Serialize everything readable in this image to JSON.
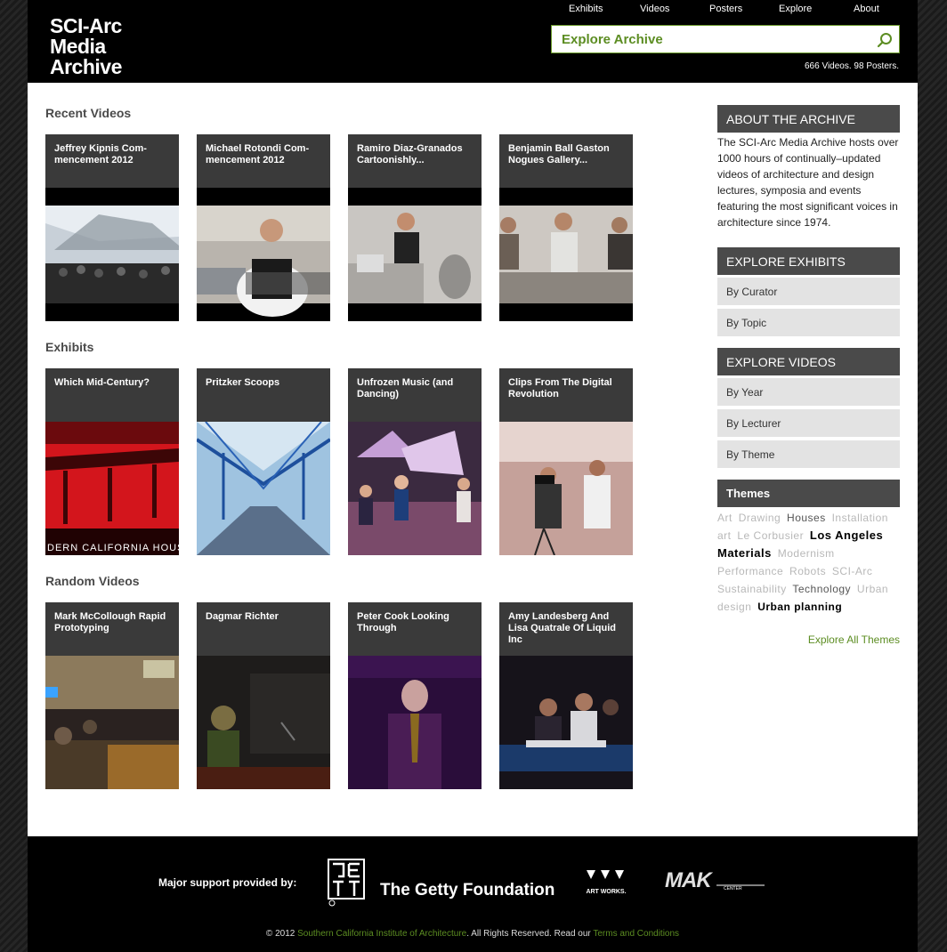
{
  "header": {
    "logo_lines": [
      "SCI-Arc",
      "Media",
      "Archive"
    ],
    "nav": [
      "Exhibits",
      "Videos",
      "Posters",
      "Explore",
      "About"
    ],
    "search_placeholder": "Explore Archive",
    "counts": "666 Videos. 98 Posters."
  },
  "sections": [
    {
      "title": "Recent Videos",
      "cards": [
        {
          "title": "Jeffrey Kipnis Com-mencement 2012"
        },
        {
          "title": "Michael Rotondi Com-mencement 2012"
        },
        {
          "title": "Ramiro Diaz-Granados Cartoonishly..."
        },
        {
          "title": "Benjamin Ball Gaston Nogues Gallery..."
        }
      ]
    },
    {
      "title": "Exhibits",
      "cards": [
        {
          "title": "Which Mid-Century?"
        },
        {
          "title": "Pritzker Scoops"
        },
        {
          "title": "Unfrozen Music (and Dancing)"
        },
        {
          "title": "Clips From The Digital Revolution"
        }
      ]
    },
    {
      "title": "Random Videos",
      "cards": [
        {
          "title": "Mark McCollough Rapid Prototyping"
        },
        {
          "title": "Dagmar Richter"
        },
        {
          "title": "Peter Cook Looking Through"
        },
        {
          "title": "Amy Landesberg And Lisa Quatrale Of Liquid Inc"
        }
      ]
    }
  ],
  "sidebar": {
    "about_title": "ABOUT THE ARCHIVE",
    "about_text": "The SCI-Arc Media Archive hosts over 1000 hours of continually–updated videos of architecture and design lectures, symposia and events featuring the most significant voices in architecture since 1974.",
    "exhibits_title": "EXPLORE EXHIBITS",
    "exhibits_items": [
      "By Curator",
      "By Topic"
    ],
    "videos_title": "EXPLORE VIDEOS",
    "videos_items": [
      "By Year",
      "By Lecturer",
      "By Theme"
    ],
    "themes_title": "Themes",
    "themes": [
      "Art",
      "Drawing",
      "Houses",
      "Installation art",
      "Le Corbusier",
      "Los Angeles",
      "Materials",
      "Modernism",
      "Performance",
      "Robots",
      "SCI-Arc",
      "Sustainability",
      "Technology",
      "Urban design",
      "Urban planning"
    ],
    "explore_all": "Explore All Themes"
  },
  "footer": {
    "support": "Major support provided by:",
    "getty": "The Getty Foundation",
    "artworks": "ART WORKS.",
    "mak": "MAK",
    "mak_sub": "CENTER",
    "copyright_prefix": "© 2012",
    "copyright_link": "Southern California Institute of Architecture",
    "copyright_mid": ". All Rights Reserved. Read our",
    "terms": "Terms and Conditions"
  }
}
